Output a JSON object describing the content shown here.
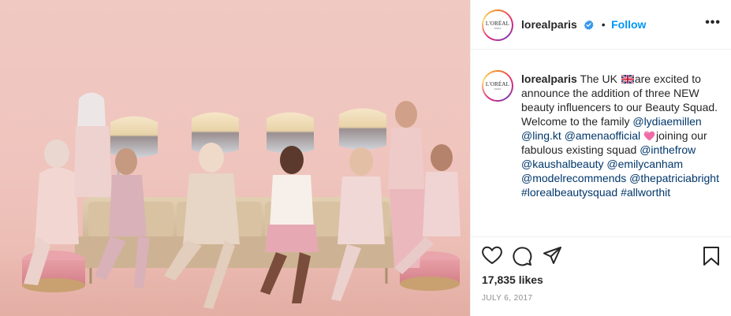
{
  "post": {
    "image_alt": "Eight women in pastel pink outfits posing on a beige sofa under salon hood dryers against a pink backdrop",
    "colors": {
      "accent": "#0095f6",
      "link": "#00376b",
      "muted": "#8e8e8e",
      "backdrop": "#efc4bd"
    }
  },
  "header": {
    "avatar_icon": "loreal-logo-icon",
    "avatar_text": "L'ORÉAL",
    "avatar_subtext": "PARIS",
    "username": "lorealparis",
    "verified_icon": "verified-badge-icon",
    "separator": "•",
    "follow_label": "Follow",
    "more_label": "•••"
  },
  "caption": {
    "username": "lorealparis",
    "seg1": " The UK ",
    "flag_icon": "uk-flag-icon",
    "seg2": "are excited to announce the addition of three NEW beauty influencers to our Beauty Squad. Welcome to the family ",
    "mention1": "@lydiaemillen",
    "mention2": "@ling.kt",
    "mention3": "@amenaofficial",
    "heart_icon": "pink-heart-icon",
    "seg3": "joining our fabulous existing squad ",
    "mention4": "@inthefrow",
    "mention5": "@kaushalbeauty",
    "mention6": "@emilycanham",
    "mention7": "@modelrecommends",
    "mention8": "@thepatriciabright",
    "hashtag1": "#lorealbeautysquad",
    "hashtag2": "#allworthit"
  },
  "actions": {
    "like_icon": "heart-outline-icon",
    "comment_icon": "comment-icon",
    "share_icon": "share-icon",
    "save_icon": "bookmark-icon"
  },
  "likes": "17,835 likes",
  "date": "JULY 6, 2017"
}
